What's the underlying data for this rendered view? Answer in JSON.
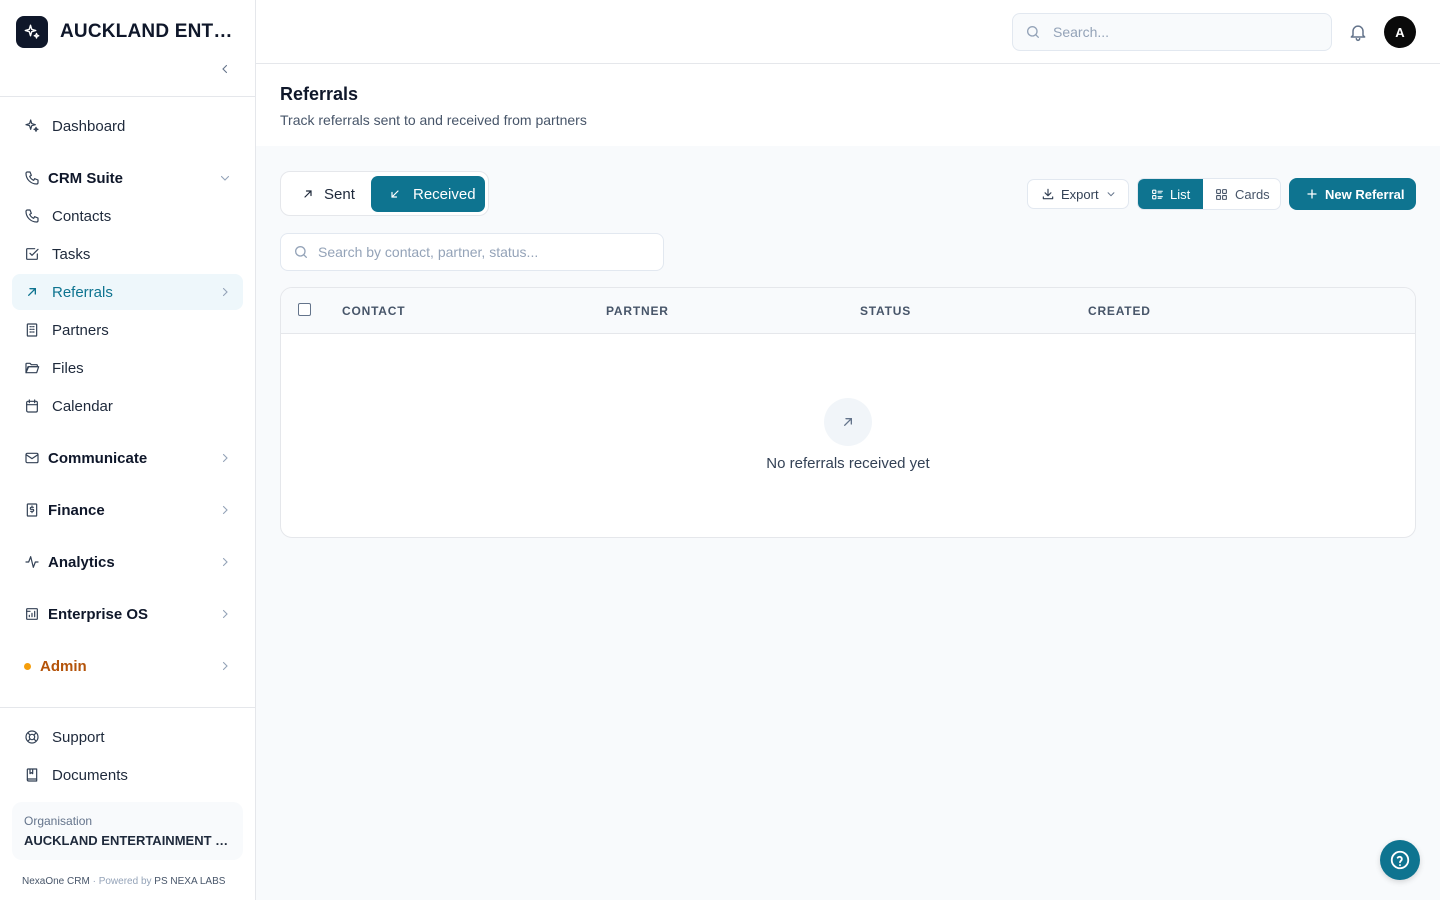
{
  "app": {
    "brand_name": "AUCKLAND ENTERPRISE",
    "organisation_label": "Organisation",
    "organisation_name": "AUCKLAND ENTERTAINMENT COMPANY",
    "footer": {
      "product": "NexaOne CRM",
      "separator": " · ",
      "powered_prefix": "Powered by ",
      "powered_by": "PS NEXA LABS"
    },
    "accent_color": "#0e7490"
  },
  "sidebar": {
    "dashboard": "Dashboard",
    "crm_suite": "CRM Suite",
    "crm_items": [
      {
        "label": "Contacts",
        "icon": "phone-icon"
      },
      {
        "label": "Tasks",
        "icon": "checkbox-icon"
      },
      {
        "label": "Referrals",
        "icon": "arrow-up-right-icon",
        "active": true
      },
      {
        "label": "Partners",
        "icon": "building-icon"
      },
      {
        "label": "Files",
        "icon": "folder-icon"
      },
      {
        "label": "Calendar",
        "icon": "calendar-icon"
      }
    ],
    "groups": [
      {
        "label": "Communicate",
        "icon": "mail-icon"
      },
      {
        "label": "Finance",
        "icon": "finance-icon"
      },
      {
        "label": "Analytics",
        "icon": "activity-icon"
      },
      {
        "label": "Enterprise OS",
        "icon": "enterprise-icon"
      },
      {
        "label": "Admin",
        "icon": "status-dot"
      }
    ],
    "support": "Support",
    "documents": "Documents"
  },
  "topbar": {
    "search_placeholder": "Search...",
    "avatar_initial": "A"
  },
  "page": {
    "title": "Referrals",
    "subtitle": "Track referrals sent to and received from partners"
  },
  "toolbar": {
    "tab_sent": "Sent",
    "tab_received": "Received",
    "active_tab": "Received",
    "export_label": "Export",
    "view_list": "List",
    "view_cards": "Cards",
    "active_view": "List",
    "new_label": "New Referral",
    "search_placeholder": "Search by contact, partner, status..."
  },
  "table": {
    "columns": [
      "CONTACT",
      "PARTNER",
      "STATUS",
      "CREATED"
    ],
    "rows": [],
    "empty_message": "No referrals received yet"
  }
}
